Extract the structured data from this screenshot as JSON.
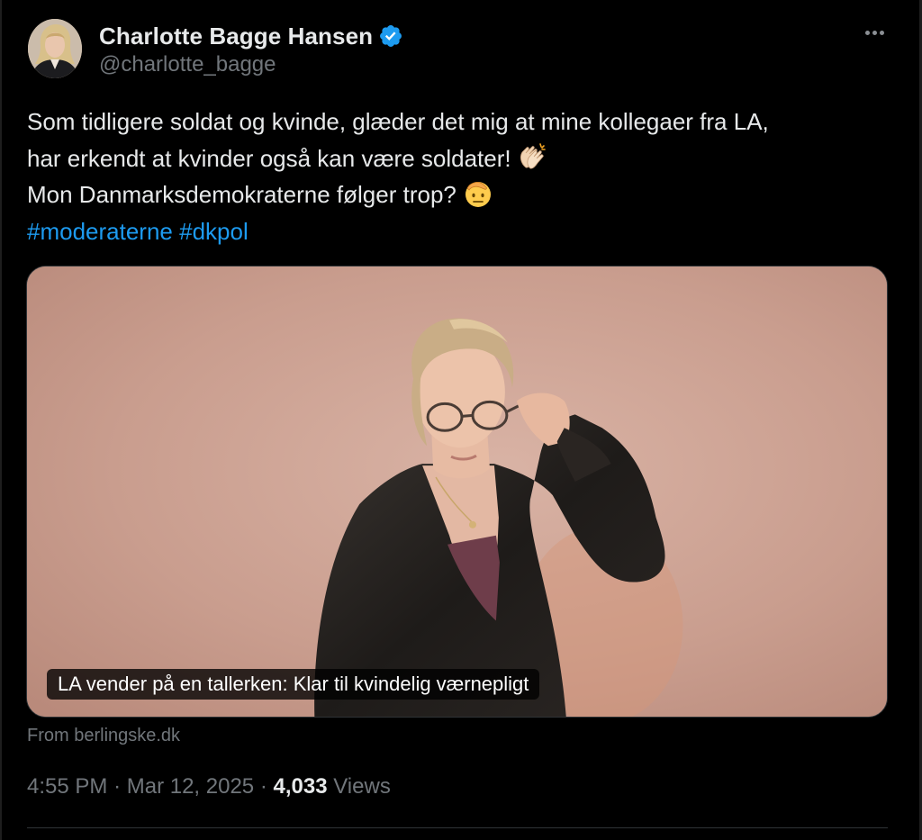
{
  "author": {
    "display_name": "Charlotte Bagge Hansen",
    "handle": "@charlotte_bagge",
    "verified": true,
    "verified_color": "#1d9bf0"
  },
  "more_menu": {
    "icon": "more-horizontal-icon"
  },
  "tweet": {
    "line1": "Som tidligere soldat og kvinde, glæder det mig at mine kollegaer fra LA,",
    "line2": "har erkendt at kvinder også kan være soldater!",
    "line2_emoji": "clapping-hands-emoji",
    "line3": "Mon Danmarksdemokraterne følger trop?",
    "line3_emoji": "saluting-face-emoji",
    "hashtags": [
      "#moderaterne",
      "#dkpol"
    ]
  },
  "link_card": {
    "title": "LA vender på en tallerken: Klar til kvindelig værnepligt",
    "source": "From berlingske.dk"
  },
  "meta": {
    "time": "4:55 PM",
    "separator": "·",
    "date": "Mar 12, 2025",
    "views_count": "4,033",
    "views_label": "Views"
  },
  "colors": {
    "background": "#000000",
    "text": "#e7e9ea",
    "secondary": "#71767b",
    "link": "#1d9bf0"
  }
}
